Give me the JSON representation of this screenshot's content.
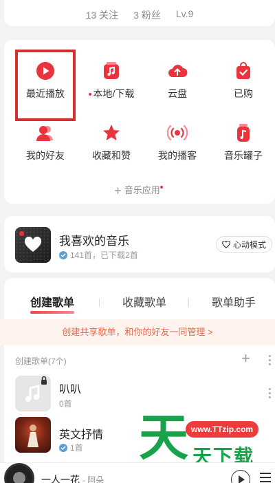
{
  "profile": {
    "follow": "13 关注",
    "fans": "3 粉丝",
    "level": "Lv.9"
  },
  "grid": {
    "items": [
      {
        "label": "最近播放",
        "icon": "play-circle-icon"
      },
      {
        "label": "本地/下载",
        "icon": "music-folder-icon",
        "dot": true
      },
      {
        "label": "云盘",
        "icon": "cloud-upload-icon"
      },
      {
        "label": "已购",
        "icon": "shopping-bag-icon"
      },
      {
        "label": "我的好友",
        "icon": "friends-icon"
      },
      {
        "label": "收藏和赞",
        "icon": "star-icon"
      },
      {
        "label": "我的播客",
        "icon": "podcast-icon"
      },
      {
        "label": "音乐罐子",
        "icon": "music-jar-icon"
      }
    ],
    "music_app_label": "音乐应用"
  },
  "favorites": {
    "title": "我喜欢的音乐",
    "subtitle": "141首，已下载2首",
    "mode_button": "心动模式"
  },
  "tabs": [
    "创建歌单",
    "收藏歌单",
    "歌单助手"
  ],
  "share_banner": "创建共享歌单，和你的好友一同管理 >",
  "playlist_header": "创建歌单(7个)",
  "playlists": [
    {
      "title": "叭叭",
      "subtitle": "0首"
    },
    {
      "title": "英文抒情",
      "subtitle": "1首"
    }
  ],
  "watermark": {
    "url": "www.TTzip.com",
    "big_char": "天",
    "text": "天下载"
  },
  "player": {
    "title": "一人一花",
    "artist": "- 阿朵"
  },
  "colors": {
    "accent": "#e8343d",
    "highlight_box": "#d32f2f",
    "banner_bg": "#fff3ed",
    "watermark_green": "#16a34a"
  }
}
